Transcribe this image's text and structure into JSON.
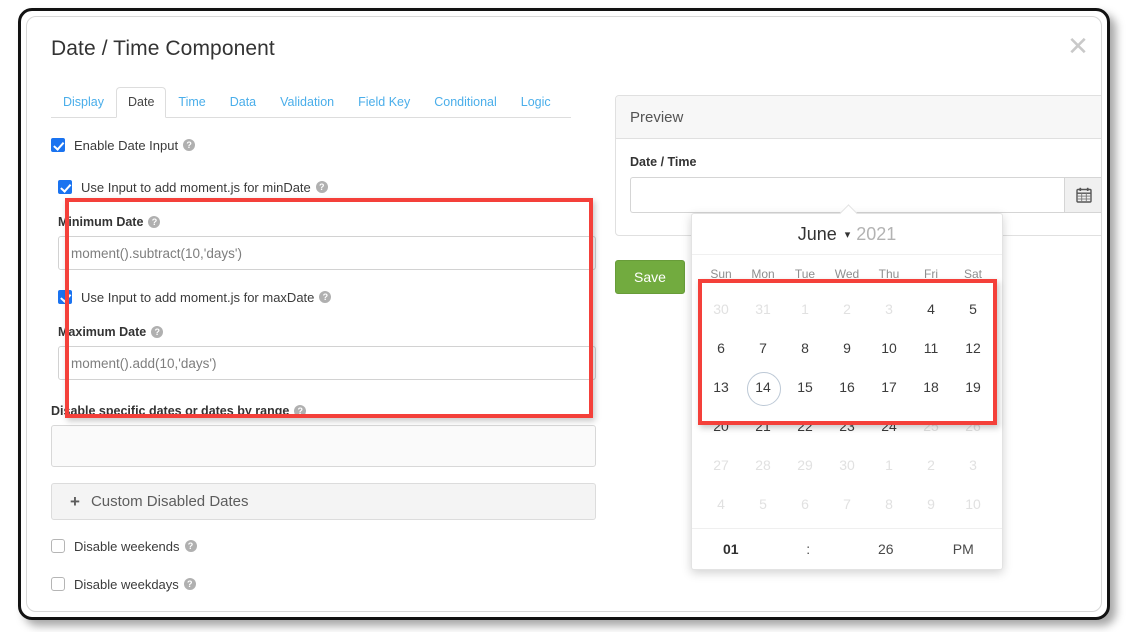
{
  "dialog": {
    "title": "Date / Time Component",
    "close_label": "✕"
  },
  "tabs": [
    {
      "label": "Display",
      "active": false
    },
    {
      "label": "Date",
      "active": true
    },
    {
      "label": "Time",
      "active": false
    },
    {
      "label": "Data",
      "active": false
    },
    {
      "label": "Validation",
      "active": false
    },
    {
      "label": "Field Key",
      "active": false
    },
    {
      "label": "Conditional",
      "active": false
    },
    {
      "label": "Logic",
      "active": false
    }
  ],
  "form": {
    "enable_date_input": {
      "label": "Enable Date Input",
      "checked": true
    },
    "min_toggle": {
      "label": "Use Input to add moment.js for minDate",
      "checked": true
    },
    "min_date": {
      "label": "Minimum Date",
      "value": "moment().subtract(10,'days')"
    },
    "max_toggle": {
      "label": "Use Input to add moment.js for maxDate",
      "checked": true
    },
    "max_date": {
      "label": "Maximum Date",
      "value": "moment().add(10,'days')"
    },
    "disable_dates": {
      "label": "Disable specific dates or dates by range",
      "value": ""
    },
    "custom_disabled_dates_button": {
      "label": "Custom Disabled Dates",
      "icon": "plus-icon"
    },
    "disable_weekends": {
      "label": "Disable weekends",
      "checked": false
    },
    "disable_weekdays": {
      "label": "Disable weekdays",
      "checked": false
    },
    "help_icon": "help-circle-icon"
  },
  "preview": {
    "header": "Preview",
    "field_label": "Date / Time",
    "field_value": "",
    "field_placeholder": "",
    "calendar_button_icon": "calendar-icon"
  },
  "actions": {
    "save_label": "Save",
    "secondary_label": ""
  },
  "calendar": {
    "month": "June",
    "month_chevron": "chevron-down-icon",
    "year": "2021",
    "dow": [
      "Sun",
      "Mon",
      "Tue",
      "Wed",
      "Thu",
      "Fri",
      "Sat"
    ],
    "weeks": [
      [
        {
          "n": "30",
          "state": "muted"
        },
        {
          "n": "31",
          "state": "muted"
        },
        {
          "n": "1",
          "state": "muted"
        },
        {
          "n": "2",
          "state": "muted"
        },
        {
          "n": "3",
          "state": "muted"
        },
        {
          "n": "4",
          "state": "enabled"
        },
        {
          "n": "5",
          "state": "enabled"
        }
      ],
      [
        {
          "n": "6",
          "state": "enabled"
        },
        {
          "n": "7",
          "state": "enabled"
        },
        {
          "n": "8",
          "state": "enabled"
        },
        {
          "n": "9",
          "state": "enabled"
        },
        {
          "n": "10",
          "state": "enabled"
        },
        {
          "n": "11",
          "state": "enabled"
        },
        {
          "n": "12",
          "state": "enabled"
        }
      ],
      [
        {
          "n": "13",
          "state": "enabled"
        },
        {
          "n": "14",
          "state": "today"
        },
        {
          "n": "15",
          "state": "enabled"
        },
        {
          "n": "16",
          "state": "enabled"
        },
        {
          "n": "17",
          "state": "enabled"
        },
        {
          "n": "18",
          "state": "enabled"
        },
        {
          "n": "19",
          "state": "enabled"
        }
      ],
      [
        {
          "n": "20",
          "state": "enabled"
        },
        {
          "n": "21",
          "state": "enabled"
        },
        {
          "n": "22",
          "state": "enabled"
        },
        {
          "n": "23",
          "state": "enabled"
        },
        {
          "n": "24",
          "state": "enabled"
        },
        {
          "n": "25",
          "state": "muted"
        },
        {
          "n": "26",
          "state": "muted"
        }
      ],
      [
        {
          "n": "27",
          "state": "muted"
        },
        {
          "n": "28",
          "state": "muted"
        },
        {
          "n": "29",
          "state": "muted"
        },
        {
          "n": "30",
          "state": "muted"
        },
        {
          "n": "1",
          "state": "muted"
        },
        {
          "n": "2",
          "state": "muted"
        },
        {
          "n": "3",
          "state": "muted"
        }
      ],
      [
        {
          "n": "4",
          "state": "muted"
        },
        {
          "n": "5",
          "state": "muted"
        },
        {
          "n": "6",
          "state": "muted"
        },
        {
          "n": "7",
          "state": "muted"
        },
        {
          "n": "8",
          "state": "muted"
        },
        {
          "n": "9",
          "state": "muted"
        },
        {
          "n": "10",
          "state": "muted"
        }
      ]
    ],
    "time": {
      "hour": "01",
      "separator": ":",
      "minute": "26",
      "meridiem": "PM"
    }
  },
  "annotations": [
    {
      "name": "min-max-date-highlight",
      "color": "#f4403a"
    },
    {
      "name": "enabled-date-range-highlight",
      "color": "#f4403a"
    }
  ],
  "colors": {
    "accent_link": "#4aaeea",
    "checkbox_checked": "#1a73f0",
    "save_green": "#72ab3f",
    "annotation_red": "#f4403a"
  }
}
